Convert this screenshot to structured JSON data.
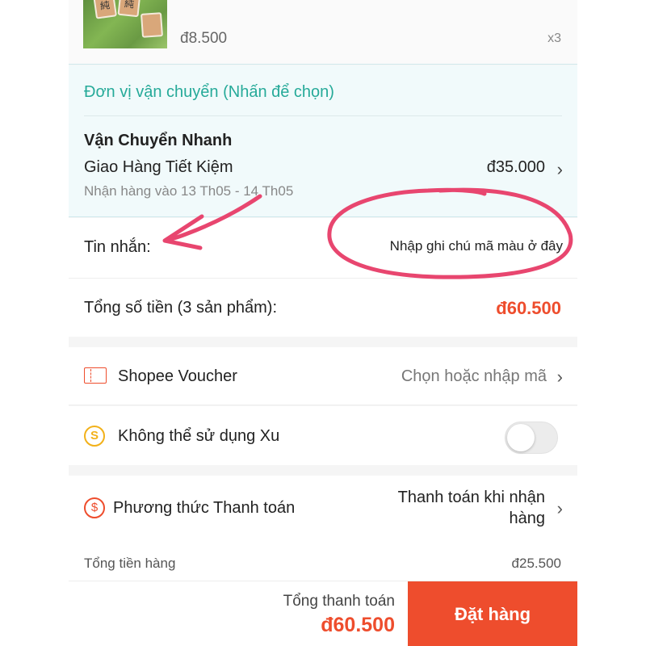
{
  "product": {
    "price": "đ8.500",
    "quantity": "x3",
    "thumb_glyphs": [
      "純",
      "純"
    ]
  },
  "shipping": {
    "section_title": "Đơn vị vận chuyển (Nhấn để chọn)",
    "method": "Vận Chuyển Nhanh",
    "carrier": "Giao Hàng Tiết Kiệm",
    "fee": "đ35.000",
    "delivery_estimate": "Nhận hàng vào 13 Th05 - 14 Th05"
  },
  "message": {
    "label": "Tin nhắn:",
    "value": "Nhập ghi chú mã màu ở đây"
  },
  "order_total": {
    "label": "Tổng số tiền (3 sản phẩm):",
    "value": "đ60.500"
  },
  "voucher": {
    "label": "Shopee Voucher",
    "action": "Chọn hoặc nhập mã",
    "icon": "voucher-ticket-icon"
  },
  "coins": {
    "label": "Không thể sử dụng Xu",
    "icon_glyph": "S",
    "toggle_on": false
  },
  "payment": {
    "label": "Phương thức Thanh toán",
    "value": "Thanh toán khi nhận hàng",
    "icon_glyph": "$"
  },
  "summary": {
    "merchandise_label": "Tổng tiền hàng",
    "merchandise_value": "đ25.500"
  },
  "bottom_bar": {
    "total_label": "Tổng thanh toán",
    "total_value": "đ60.500",
    "order_button": "Đặt hàng"
  },
  "chevron": "›",
  "colors": {
    "accent": "#ee4d2d",
    "shipping_teal": "#26aa99",
    "annotation_pink": "#e8466f",
    "coin_yellow": "#f2b11a"
  }
}
